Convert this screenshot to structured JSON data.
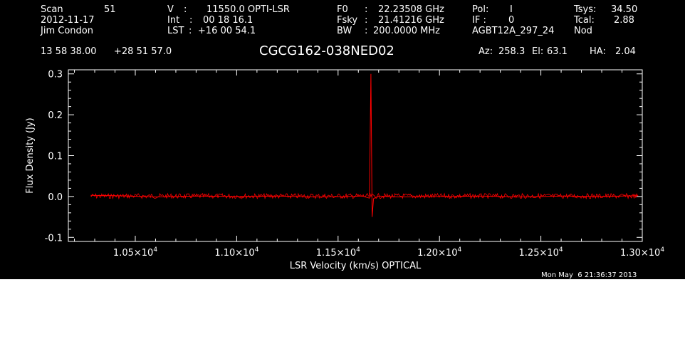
{
  "header": {
    "scan_label": "Scan",
    "scan_value": "51",
    "date": "2012-11-17",
    "observer": "Jim Condon",
    "v_label": "V",
    "v_value": "11550.0 OPTI-LSR",
    "int_label": "Int",
    "int_value": "00 18 16.1",
    "lst_label": "LST",
    "lst_value": "+16 00 54.1",
    "f0_label": "F0",
    "f0_value": "22.23508 GHz",
    "fsky_label": "Fsky",
    "fsky_value": "21.41216 GHz",
    "bw_label": "BW",
    "bw_value": "200.0000 MHz",
    "pol_label": "Pol:",
    "pol_value": "I",
    "if_label": "IF :",
    "if_value": "0",
    "project": "AGBT12A_297_24",
    "tsys_label": "Tsys:",
    "tsys_value": "34.50",
    "tcal_label": "Tcal:",
    "tcal_value": "2.88",
    "mode": "Nod",
    "ra": "13 58 38.00",
    "dec": "+28 51 57.0",
    "source": "CGCG162-038NED02",
    "az_label": "Az:",
    "az_value": "258.3",
    "el_label": "El:",
    "el_value": "63.1",
    "ha_label": "HA:",
    "ha_value": "2.04",
    "timestamp": "Mon May  6 21:36:37 2013"
  },
  "colors": {
    "background": "#000000",
    "axes": "#ffffff",
    "trace": "#ff0000"
  },
  "chart_data": {
    "type": "line",
    "xlabel": "LSR Velocity (km/s) OPTICAL",
    "ylabel": "Flux Density (Jy)",
    "xlim": [
      10170,
      13000
    ],
    "ylim": [
      -0.11,
      0.31
    ],
    "xticks": [
      {
        "value": 10500,
        "mant": "1.05",
        "exp": "4"
      },
      {
        "value": 11000,
        "mant": "1.10",
        "exp": "4"
      },
      {
        "value": 11500,
        "mant": "1.15",
        "exp": "4"
      },
      {
        "value": 12000,
        "mant": "1.20",
        "exp": "4"
      },
      {
        "value": 12500,
        "mant": "1.25",
        "exp": "4"
      },
      {
        "value": 13000,
        "mant": "1.30",
        "exp": "4"
      }
    ],
    "yticks": [
      {
        "value": -0.1,
        "label": "-0.1"
      },
      {
        "value": 0.0,
        "label": "0.0"
      },
      {
        "value": 0.1,
        "label": "0.1"
      },
      {
        "value": 0.2,
        "label": "0.2"
      },
      {
        "value": 0.3,
        "label": "0.3"
      }
    ],
    "series": [
      {
        "x": [
          10280,
          10400,
          10600,
          10800,
          11000,
          11200,
          11400,
          11550,
          11620,
          11655,
          11662,
          11668,
          11675,
          11700,
          11800,
          12000,
          12200,
          12400,
          12600,
          12800,
          12980
        ],
        "y": [
          0.003,
          0.002,
          -0.001,
          0.001,
          0.0,
          0.001,
          -0.001,
          0.0,
          0.001,
          -0.004,
          0.3,
          -0.05,
          -0.005,
          0.001,
          -0.001,
          0.0,
          0.001,
          -0.001,
          0.001,
          0.0,
          0.002
        ]
      }
    ]
  }
}
